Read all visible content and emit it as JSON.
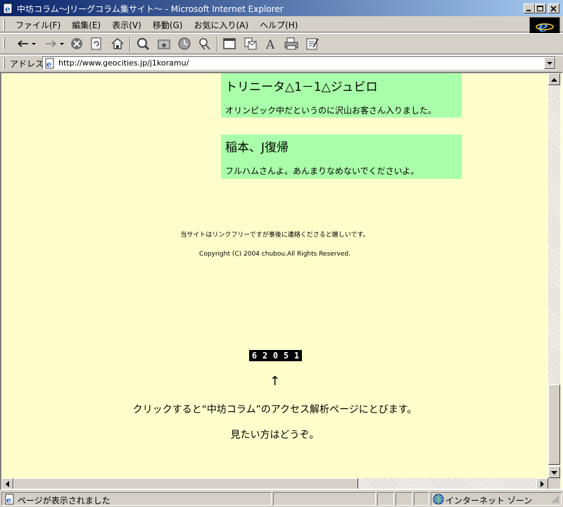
{
  "window": {
    "title": "中坊コラム～Jリーグコラム集サイト～ - Microsoft Internet Explorer"
  },
  "menu": {
    "items": [
      "ファイル(F)",
      "編集(E)",
      "表示(V)",
      "移動(G)",
      "お気に入り(A)",
      "ヘルプ(H)"
    ]
  },
  "address": {
    "label": "アドレス",
    "url": "http://www.geocities.jp/j1koramu/"
  },
  "content": {
    "news": [
      {
        "headline": "トリニータ△1－1△ジュビロ",
        "body": "オリンピック中だというのに沢山お客さん入りました。"
      },
      {
        "headline": "稲本、J復帰",
        "body": "フルハムさんよ。あんまりなめないでくださいよ。"
      }
    ],
    "link_note": "当サイトはリンクフリーですが事後に連絡くださると嬉しいです。",
    "copyright": "Copyright (C) 2004 chubou.All Rights Reserved.",
    "counter_digits": [
      "6",
      "2",
      "0",
      "5",
      "1"
    ],
    "arrow": "↑",
    "access_note": "クリックすると“中坊コラム”のアクセス解析ページにとびます。",
    "welcome": "見たい方はどうぞ。"
  },
  "status": {
    "text": "ページが表示されました",
    "zone": "インターネット ゾーン"
  },
  "colors": {
    "page_background": "#ffffcc",
    "news_box": "#aaffaa",
    "titlebar_start": "#0a246a",
    "titlebar_end": "#a6caf0"
  }
}
